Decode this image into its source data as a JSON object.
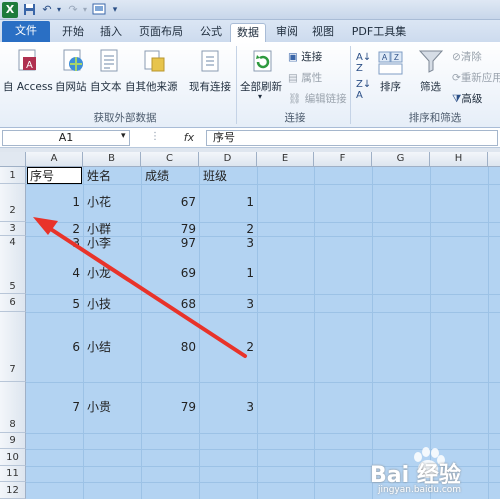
{
  "quick_access": {
    "save_icon": "save-icon",
    "undo_icon": "undo-icon",
    "redo_icon": "redo-icon",
    "print_icon": "print-preview-icon"
  },
  "tabs": [
    {
      "label": "文件"
    },
    {
      "label": "开始"
    },
    {
      "label": "插入"
    },
    {
      "label": "页面布局"
    },
    {
      "label": "公式"
    },
    {
      "label": "数据"
    },
    {
      "label": "审阅"
    },
    {
      "label": "视图"
    },
    {
      "label": "PDF工具集"
    }
  ],
  "ribbon": {
    "get_external": {
      "buttons": [
        "自 Access",
        "自网站",
        "自文本",
        "自其他来源",
        "现有连接"
      ],
      "label": "获取外部数据"
    },
    "connections": {
      "refresh": "全部刷新",
      "items": [
        "连接",
        "属性",
        "编辑链接"
      ],
      "label": "连接"
    },
    "sort_filter": {
      "sort": "排序",
      "filter": "筛选",
      "items": [
        "清除",
        "重新应用",
        "高级"
      ],
      "label": "排序和筛选"
    }
  },
  "formula_bar": {
    "name_box": "A1",
    "fx": "fx",
    "content": "序号"
  },
  "columns": [
    "A",
    "B",
    "C",
    "D",
    "E",
    "F",
    "G",
    "H"
  ],
  "rows": [
    "1",
    "2",
    "3",
    "4",
    "5",
    "6",
    "7",
    "8",
    "9",
    "10",
    "11",
    "12"
  ],
  "table": {
    "headers": [
      "序号",
      "姓名",
      "成绩",
      "班级"
    ],
    "records": [
      [
        "1",
        "小花",
        "67",
        "1"
      ],
      [
        "2",
        "小群",
        "79",
        "2"
      ],
      [
        "3",
        "小李",
        "97",
        "3"
      ],
      [
        "4",
        "小龙",
        "69",
        "1"
      ],
      [
        "5",
        "小技",
        "68",
        "3"
      ],
      [
        "6",
        "小结",
        "80",
        "2"
      ],
      [
        "7",
        "小贵",
        "79",
        "3"
      ]
    ]
  },
  "watermark": {
    "brand": "Bai 经验",
    "url": "jingyan.baidu.com"
  },
  "colors": {
    "selection": "#b3d3f2",
    "arrow": "#e8332a",
    "file_tab": "#2a6fc4"
  }
}
